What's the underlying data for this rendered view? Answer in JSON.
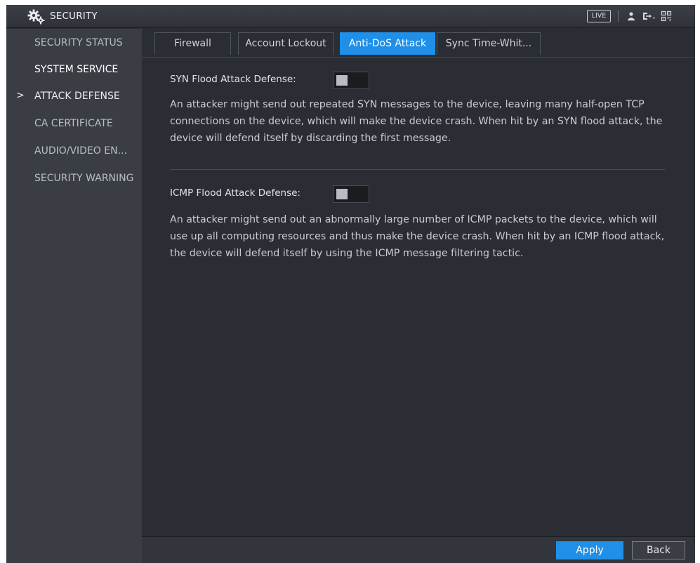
{
  "window": {
    "title": "SECURITY",
    "live_label": "LIVE"
  },
  "sidebar": {
    "items": [
      {
        "label": "SECURITY STATUS"
      },
      {
        "label": "SYSTEM SERVICE"
      },
      {
        "label": "ATTACK DEFENSE",
        "arrow": ">"
      },
      {
        "label": "CA CERTIFICATE"
      },
      {
        "label": "AUDIO/VIDEO EN..."
      },
      {
        "label": "SECURITY WARNING"
      }
    ]
  },
  "tabs": [
    {
      "label": "Firewall"
    },
    {
      "label": "Account Lockout"
    },
    {
      "label": "Anti-DoS Attack"
    },
    {
      "label": "Sync Time-Whit..."
    }
  ],
  "syn": {
    "label": "SYN Flood Attack Defense:",
    "enabled": false,
    "description": "An attacker might send out repeated SYN messages to the device, leaving many half-open TCP connections on the device, which will make the device crash. When hit by an SYN flood attack, the device will defend itself by discarding the first message."
  },
  "icmp": {
    "label": "ICMP Flood Attack Defense:",
    "enabled": false,
    "description": "An attacker might send out an abnormally large number of ICMP packets to the device, which will use up all computing resources and thus make the device crash. When hit by an ICMP flood attack, the device will defend itself by using the ICMP message filtering tactic."
  },
  "footer": {
    "apply_label": "Apply",
    "back_label": "Back"
  },
  "colors": {
    "accent": "#1f8fe8",
    "background": "#2a2d34",
    "sidebar": "#3a3d44"
  },
  "icons": {
    "title": "gear-icon",
    "user": "user-icon",
    "logout": "logout-icon",
    "qr": "qr-code-icon"
  }
}
